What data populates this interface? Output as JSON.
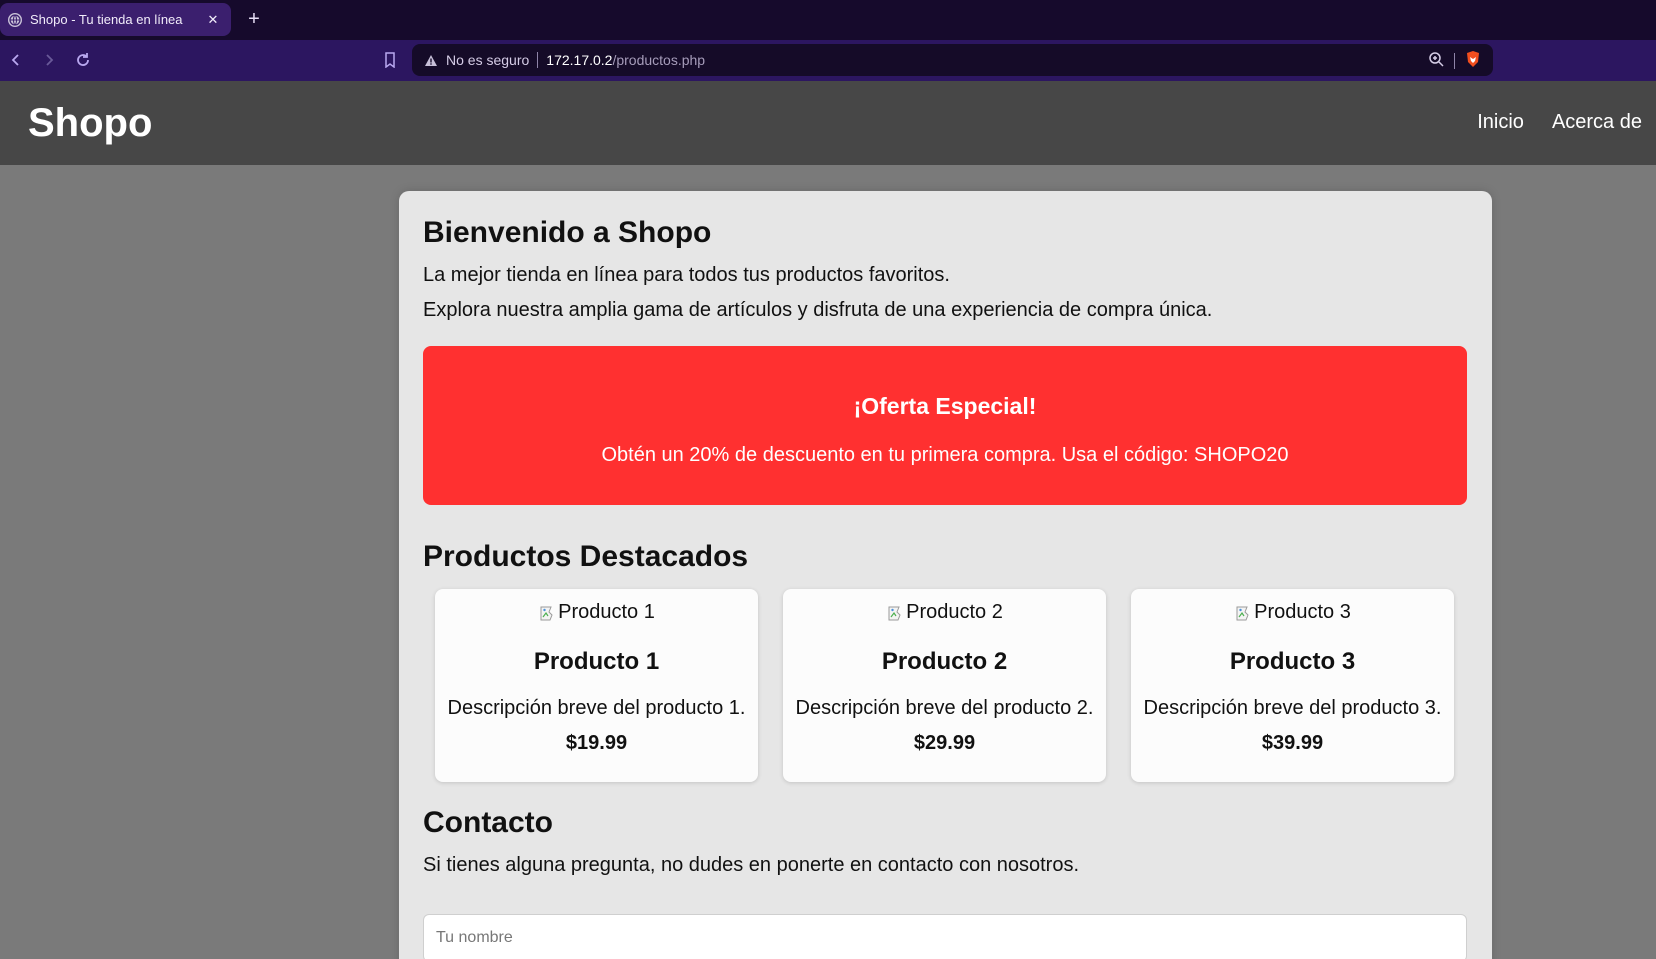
{
  "browser": {
    "tab_title": "Shopo - Tu tienda en línea",
    "close_glyph": "✕",
    "newtab_glyph": "+",
    "security_text": "No es seguro",
    "url_host": "172.17.0.2",
    "url_path": "/productos.php",
    "accent_color": "#2c1660"
  },
  "header": {
    "logo": "Shopo",
    "nav": [
      "Inicio",
      "Acerca de"
    ]
  },
  "main": {
    "welcome_title": "Bienvenido a Shopo",
    "intro_1": "La mejor tienda en línea para todos tus productos favoritos.",
    "intro_2": "Explora nuestra amplia gama de artículos y disfruta de una experiencia de compra única.",
    "offer": {
      "title": "¡Oferta Especial!",
      "text": "Obtén un 20% de descuento en tu primera compra. Usa el código: SHOPO20",
      "color": "#ff3030"
    },
    "products_title": "Productos Destacados",
    "products": [
      {
        "img_alt": "Producto 1",
        "name": "Producto 1",
        "desc": "Descripción breve del producto 1.",
        "price": "$19.99"
      },
      {
        "img_alt": "Producto 2",
        "name": "Producto 2",
        "desc": "Descripción breve del producto 2.",
        "price": "$29.99"
      },
      {
        "img_alt": "Producto 3",
        "name": "Producto 3",
        "desc": "Descripción breve del producto 3.",
        "price": "$39.99"
      }
    ],
    "contact_title": "Contacto",
    "contact_text": "Si tienes alguna pregunta, no dudes en ponerte en contacto con nosotros.",
    "name_placeholder": "Tu nombre"
  },
  "icons": [
    "globe-icon",
    "close-icon",
    "plus-icon",
    "back-icon",
    "forward-icon",
    "reload-icon",
    "bookmark-icon",
    "warning-icon",
    "zoom-icon",
    "brave-shield-icon",
    "broken-image-icon"
  ]
}
